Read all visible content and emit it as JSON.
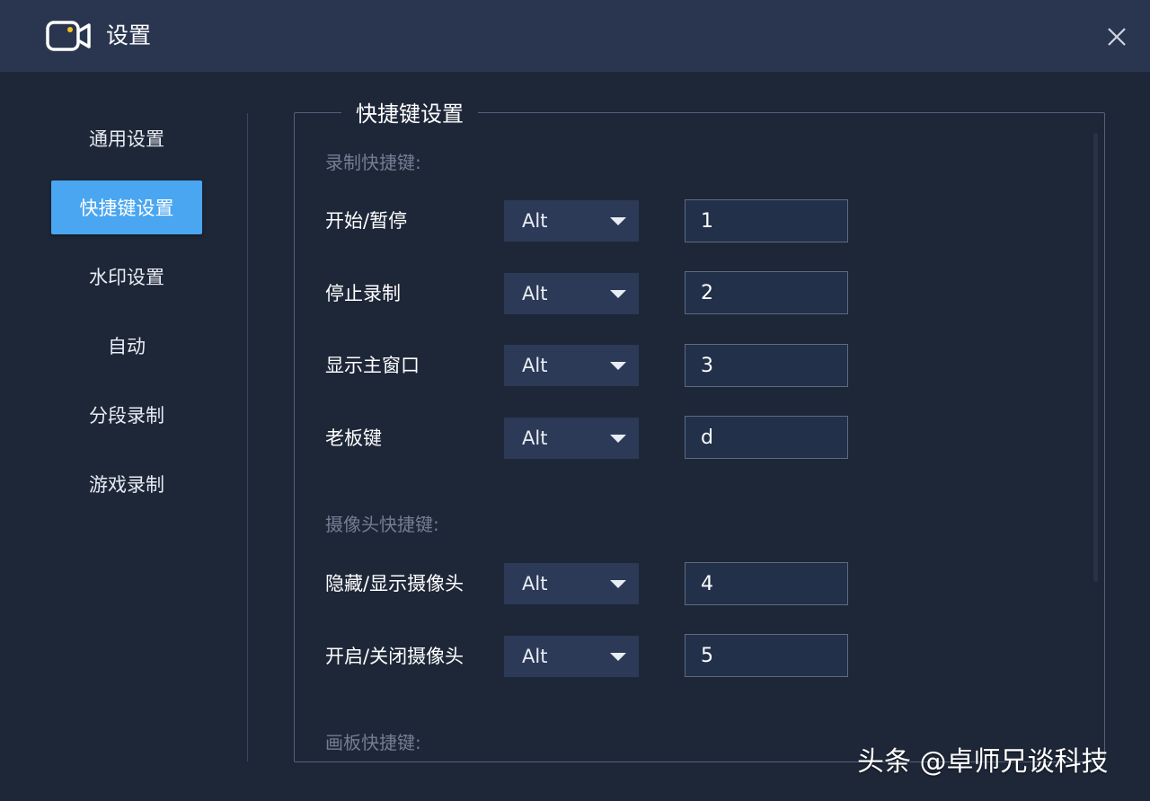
{
  "window": {
    "title": "设置",
    "icon": "video-camera-icon",
    "close_icon": "close-icon"
  },
  "sidebar": {
    "active_color": "#4aa6f0",
    "items": [
      {
        "label": "通用设置",
        "active": false
      },
      {
        "label": "快捷键设置",
        "active": true
      },
      {
        "label": "水印设置",
        "active": false
      },
      {
        "label": "自动",
        "active": false
      },
      {
        "label": "分段录制",
        "active": false
      },
      {
        "label": "游戏录制",
        "active": false
      }
    ]
  },
  "panel": {
    "title": "快捷键设置",
    "sections": [
      {
        "label": "录制快捷键:",
        "rows": [
          {
            "label": "开始/暂停",
            "modifier": "Alt",
            "key": "1"
          },
          {
            "label": "停止录制",
            "modifier": "Alt",
            "key": "2"
          },
          {
            "label": "显示主窗口",
            "modifier": "Alt",
            "key": "3"
          },
          {
            "label": "老板键",
            "modifier": "Alt",
            "key": "d"
          }
        ]
      },
      {
        "label": "摄像头快捷键:",
        "rows": [
          {
            "label": "隐藏/显示摄像头",
            "modifier": "Alt",
            "key": "4"
          },
          {
            "label": "开启/关闭摄像头",
            "modifier": "Alt",
            "key": "5"
          }
        ]
      },
      {
        "label": "画板快捷键:",
        "rows": []
      }
    ]
  },
  "watermark": "头条 @卓师兄谈科技"
}
